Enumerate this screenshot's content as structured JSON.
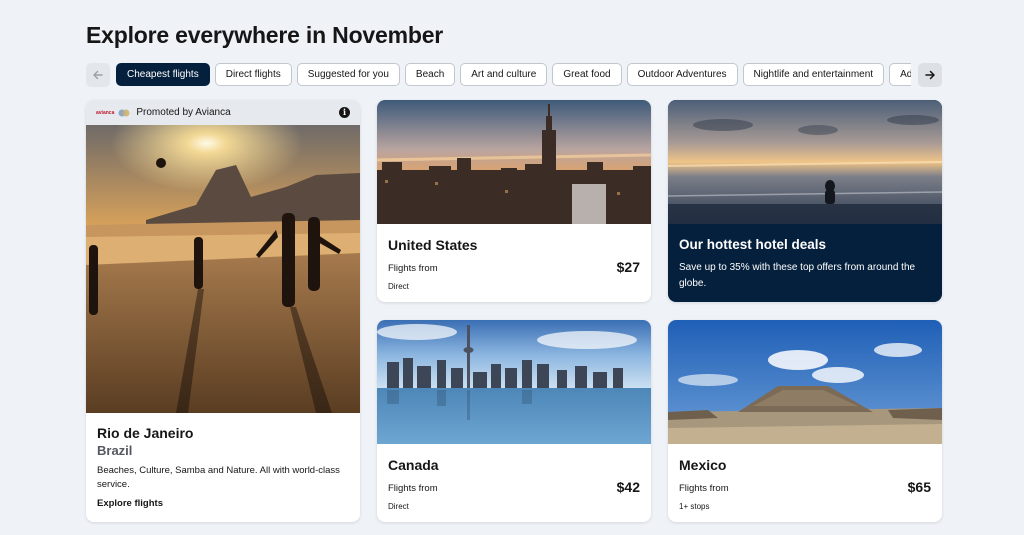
{
  "page": {
    "heading": "Explore everywhere in November"
  },
  "filters": {
    "chips": [
      "Cheapest flights",
      "Direct flights",
      "Suggested for you",
      "Beach",
      "Art and culture",
      "Great food",
      "Outdoor Adventures",
      "Nightlife and entertainment",
      "Adventure"
    ],
    "active_index": 0,
    "prev_icon": "arrow-left-icon",
    "next_icon": "arrow-right-icon"
  },
  "promoted": {
    "brand": "avianca",
    "label": "Promoted by Avianca",
    "city": "Rio de Janeiro",
    "country": "Brazil",
    "description": "Beaches, Culture, Samba and Nature. All with world-class service.",
    "cta": "Explore flights",
    "info_icon": "info-icon"
  },
  "destinations": [
    {
      "name": "United States",
      "from_label": "Flights from",
      "price": "$27",
      "stops": "Direct"
    },
    {
      "name": "Canada",
      "from_label": "Flights from",
      "price": "$42",
      "stops": "Direct"
    },
    {
      "name": "Mexico",
      "from_label": "Flights from",
      "price": "$65",
      "stops": "1+ stops"
    }
  ],
  "hotel": {
    "title": "Our hottest hotel deals",
    "description": "Save up to 35% with these top offers from around the globe."
  },
  "colors": {
    "accent_dark": "#05203c",
    "background": "#eff3f8",
    "card": "#ffffff"
  }
}
